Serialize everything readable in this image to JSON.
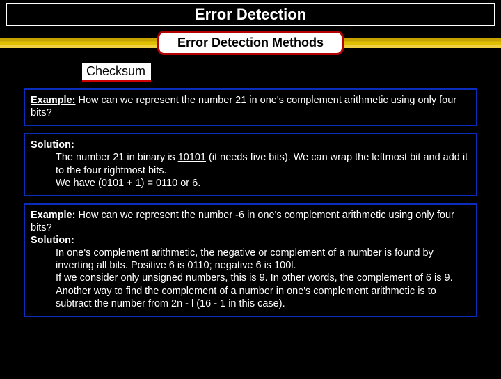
{
  "title": "Error Detection",
  "method_box": "Error Detection Methods",
  "section": "Checksum",
  "box1": {
    "example_label": "Example:",
    "example_text": " How can we represent the number 21 in one's complement arithmetic using only four bits?"
  },
  "box2": {
    "solution_label": "Solution:",
    "line1a": "The number 21 in binary is ",
    "binary": "10101",
    "line1b": " (it needs five bits).  We can wrap the leftmost bit and add it to the four rightmost bits.",
    "line2": "We have (0101 + 1) = 0110 or 6."
  },
  "box3": {
    "example_label": "Example:",
    "example_text": " How can we represent the number -6 in one's complement arithmetic using only four bits?",
    "solution_label": "Solution:",
    "sol_line1": "In one's complement arithmetic, the negative or complement of a number is found by inverting all bits. Positive 6 is 0110; negative 6 is 100l.",
    "sol_line2": "If we consider only unsigned numbers, this is 9. In other words, the complement of 6 is 9. Another way to find the complement of a number in one's complement arithmetic is to subtract the number from 2n - l (16 - 1 in this case)."
  }
}
